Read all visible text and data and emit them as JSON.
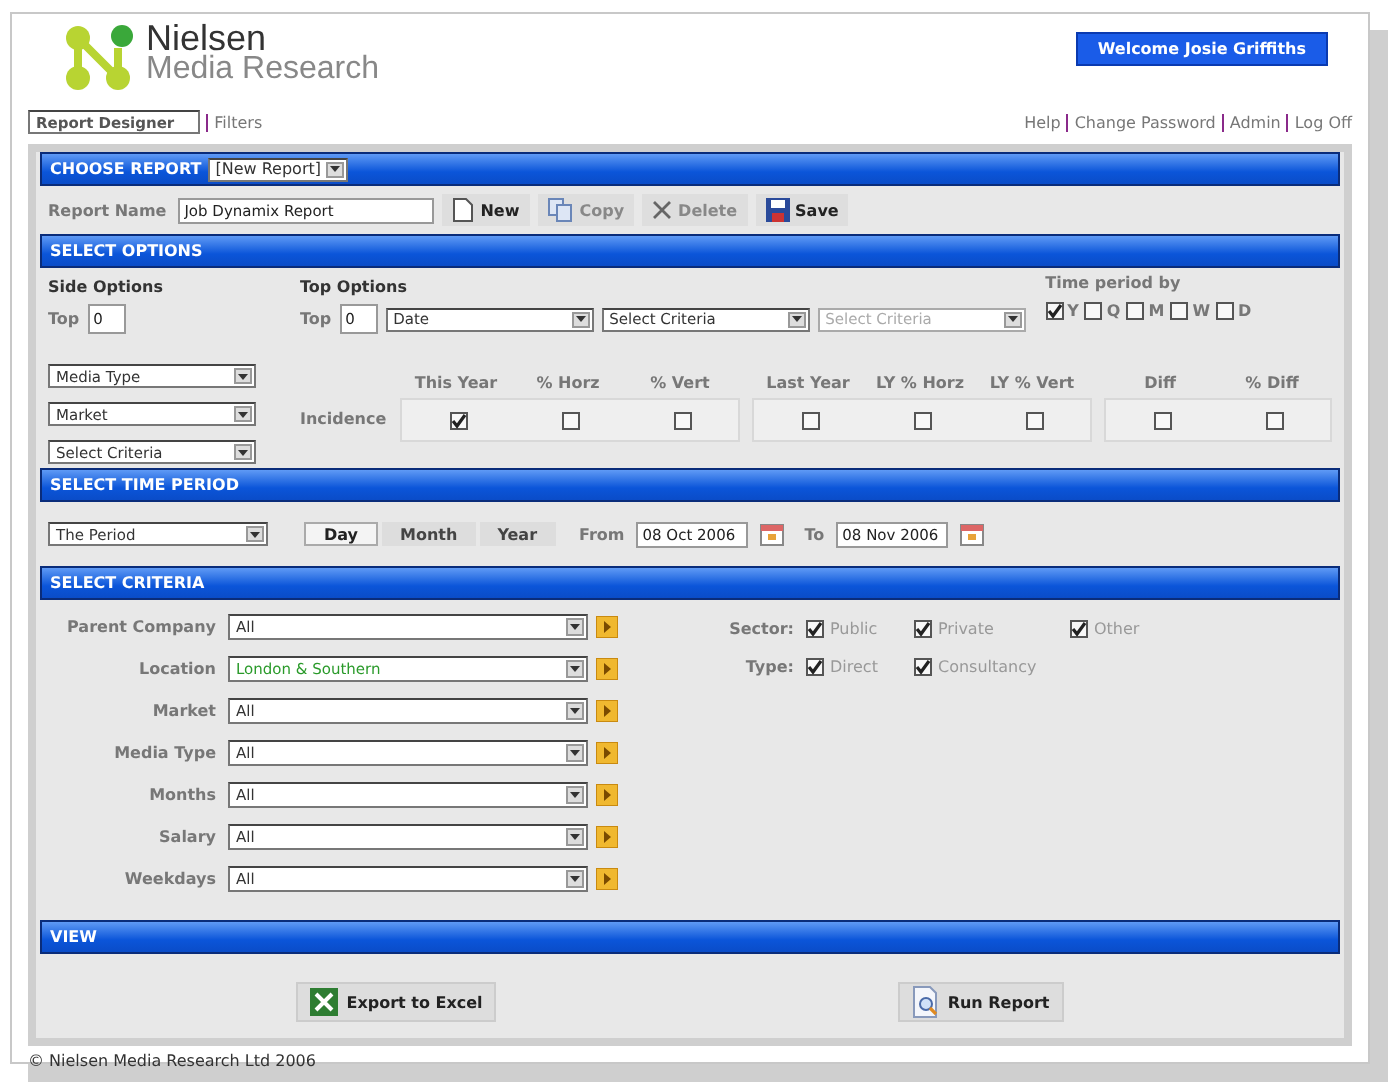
{
  "header": {
    "logo_top": "Nielsen",
    "logo_bottom": "Media Research",
    "welcome": "Welcome Josie Griffiths"
  },
  "nav_left": [
    {
      "label": "Report Designer",
      "selected": true
    },
    {
      "label": "Filters",
      "selected": false
    }
  ],
  "nav_right": [
    "Help",
    "Change Password",
    "Admin",
    "Log Off"
  ],
  "choose_report": {
    "title": "CHOOSE REPORT",
    "dropdown": "[New Report]",
    "name_label": "Report Name",
    "name_value": "Job Dynamix Report",
    "actions": [
      {
        "label": "New",
        "kind": "new",
        "disabled": false
      },
      {
        "label": "Copy",
        "kind": "copy",
        "disabled": true
      },
      {
        "label": "Delete",
        "kind": "delete",
        "disabled": true
      },
      {
        "label": "Save",
        "kind": "save",
        "disabled": false
      }
    ]
  },
  "select_options": {
    "title": "SELECT OPTIONS",
    "side": {
      "heading": "Side Options",
      "top_label": "Top",
      "top_value": "0",
      "dropdowns": [
        {
          "value": "Media Type"
        },
        {
          "value": "Market"
        },
        {
          "value": "Select Criteria"
        }
      ]
    },
    "top": {
      "heading": "Top Options",
      "top_label": "Top",
      "top_value": "0",
      "dropdowns": [
        {
          "value": "Date",
          "disabled": false
        },
        {
          "value": "Select Criteria",
          "disabled": false
        },
        {
          "value": "Select Criteria",
          "disabled": true
        }
      ]
    },
    "time_period_by": {
      "label": "Time period by",
      "options": [
        {
          "label": "Y",
          "checked": true
        },
        {
          "label": "Q",
          "checked": false
        },
        {
          "label": "M",
          "checked": false
        },
        {
          "label": "W",
          "checked": false
        },
        {
          "label": "D",
          "checked": false
        }
      ]
    },
    "measure_label": "Incidence",
    "measure_groups": [
      {
        "items": [
          {
            "label": "This Year",
            "checked": true
          },
          {
            "label": "% Horz",
            "checked": false
          },
          {
            "label": "% Vert",
            "checked": false
          }
        ]
      },
      {
        "items": [
          {
            "label": "Last Year",
            "checked": false
          },
          {
            "label": "LY % Horz",
            "checked": false
          },
          {
            "label": "LY % Vert",
            "checked": false
          }
        ]
      },
      {
        "items": [
          {
            "label": "Diff",
            "checked": false
          },
          {
            "label": "% Diff",
            "checked": false
          }
        ]
      }
    ]
  },
  "time_period": {
    "title": "SELECT TIME PERIOD",
    "dropdown": "The Period",
    "units": [
      {
        "label": "Day",
        "selected": true
      },
      {
        "label": "Month",
        "selected": false
      },
      {
        "label": "Year",
        "selected": false
      }
    ],
    "from_label": "From",
    "from_value": "08 Oct 2006",
    "to_label": "To",
    "to_value": "08 Nov 2006"
  },
  "criteria": {
    "title": "SELECT CRITERIA",
    "rows": [
      {
        "label": "Parent Company",
        "value": "All",
        "highlighted": false
      },
      {
        "label": "Location",
        "value": "London & Southern",
        "highlighted": true
      },
      {
        "label": "Market",
        "value": "All",
        "highlighted": false
      },
      {
        "label": "Media Type",
        "value": "All",
        "highlighted": false
      },
      {
        "label": "Months",
        "value": "All",
        "highlighted": false
      },
      {
        "label": "Salary",
        "value": "All",
        "highlighted": false
      },
      {
        "label": "Weekdays",
        "value": "All",
        "highlighted": false
      }
    ],
    "filters": [
      {
        "label": "Sector:",
        "options": [
          {
            "label": "Public",
            "checked": true
          },
          {
            "label": "Private",
            "checked": true
          },
          {
            "label": "Other",
            "checked": true
          }
        ]
      },
      {
        "label": "Type:",
        "options": [
          {
            "label": "Direct",
            "checked": true
          },
          {
            "label": "Consultancy",
            "checked": true
          }
        ]
      }
    ]
  },
  "view": {
    "title": "VIEW",
    "buttons": [
      {
        "label": "Export to Excel",
        "kind": "excel"
      },
      {
        "label": "Run Report",
        "kind": "run"
      }
    ]
  },
  "footer": "© Nielsen Media Research Ltd 2006"
}
